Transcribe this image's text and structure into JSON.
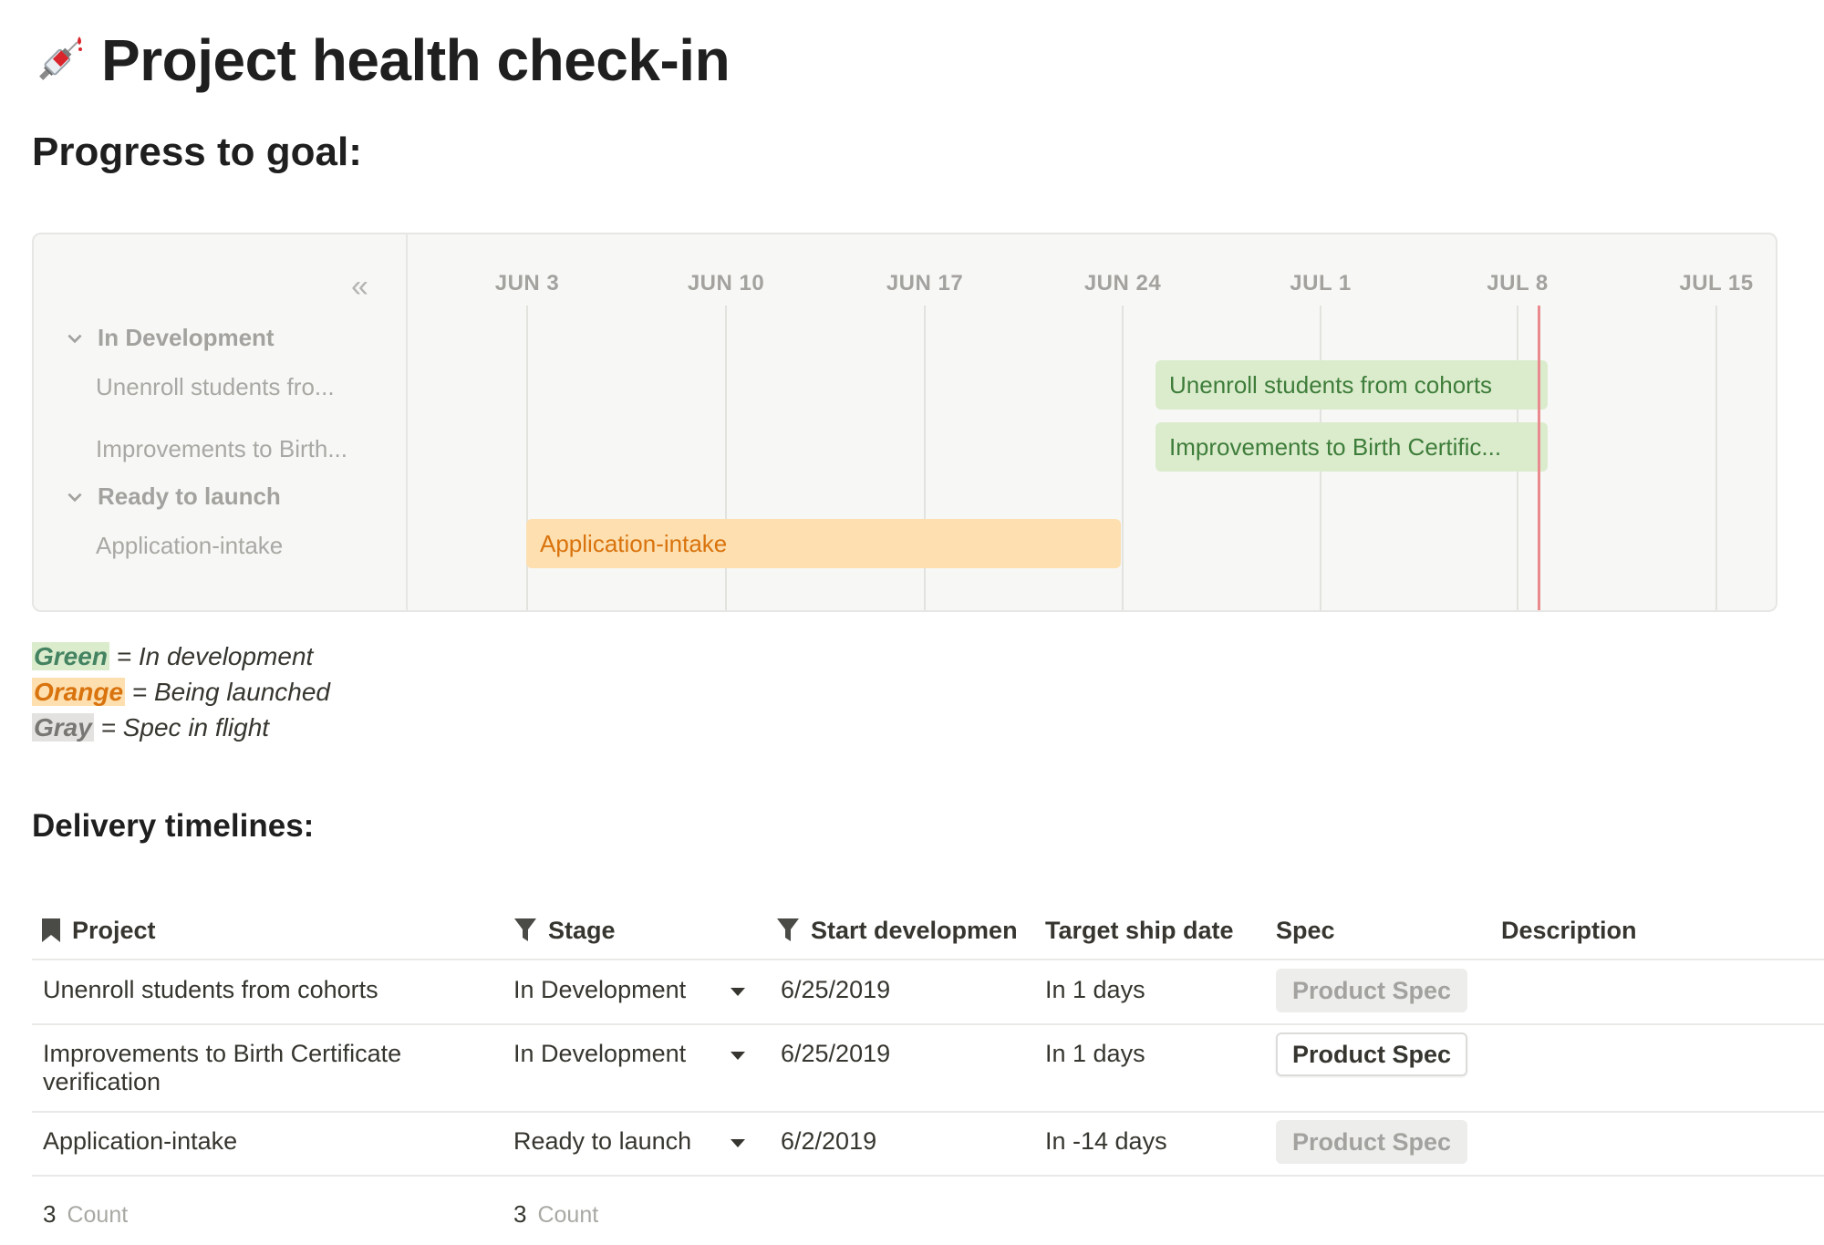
{
  "page": {
    "title": "Project health check-in",
    "icon": "syringe-icon"
  },
  "sections": {
    "progress_heading": "Progress to goal:",
    "delivery_heading": "Delivery timelines:"
  },
  "timeline": {
    "collapse_icon": "double-chevron-left-icon",
    "dates": [
      "JUN 3",
      "JUN 10",
      "JUN 17",
      "JUN 24",
      "JUL 1",
      "JUL 8",
      "JUL 15"
    ],
    "groups": [
      {
        "label": "In Development",
        "items": [
          {
            "side_label": "Unenroll students fro...",
            "bar_label": "Unenroll students from cohorts",
            "color": "green"
          },
          {
            "side_label": "Improvements to Birth...",
            "bar_label": "Improvements to Birth Certific...",
            "color": "green"
          }
        ]
      },
      {
        "label": "Ready to launch",
        "items": [
          {
            "side_label": "Application-intake",
            "bar_label": "Application-intake",
            "color": "orange"
          }
        ]
      }
    ],
    "colors": {
      "green_bg": "#dbeccd",
      "green_text": "#3e7d3a",
      "orange_bg": "#fddfb0",
      "orange_text": "#d9730d",
      "today": "#eb8a8e"
    }
  },
  "legend": [
    {
      "key": "Green",
      "desc": " = In development"
    },
    {
      "key": "Orange",
      "desc": " = Being launched"
    },
    {
      "key": "Gray",
      "desc": " = Spec in flight"
    }
  ],
  "table": {
    "headers": {
      "project": "Project",
      "stage": "Stage",
      "start": "Start developmen",
      "target": "Target ship date",
      "spec": "Spec",
      "description": "Description"
    },
    "header_icons": {
      "project": "bookmark-icon",
      "stage": "filter-icon",
      "start": "filter-icon"
    },
    "rows": [
      {
        "project_line1": "Unenroll students from cohorts",
        "project_line2": "",
        "stage": "In Development",
        "start": "6/25/2019",
        "target": "In 1 days",
        "spec": "Product Spec",
        "description": ""
      },
      {
        "project_line1": "Improvements to Birth Certificate",
        "project_line2": "verification",
        "stage": "In Development",
        "start": "6/25/2019",
        "target": "In 1 days",
        "spec": "Product Spec",
        "description": ""
      },
      {
        "project_line1": "Application-intake",
        "project_line2": "",
        "stage": "Ready to launch",
        "start": "6/2/2019",
        "target": "In -14 days",
        "spec": "Product Spec",
        "description": ""
      }
    ],
    "footer": {
      "project_count": "3",
      "project_count_label": "Count",
      "stage_count": "3",
      "stage_count_label": "Count"
    }
  }
}
